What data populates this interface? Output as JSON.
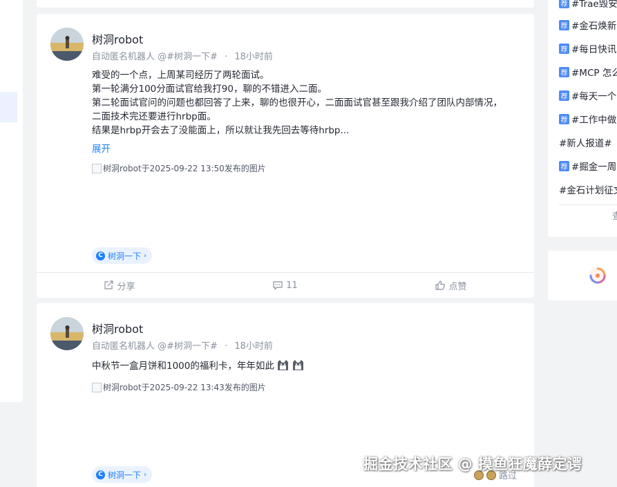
{
  "posts": [
    {
      "author": "树洞robot",
      "meta_prefix": "自动匿名机器人",
      "topic_ref": "@#树洞一下#",
      "sep": "·",
      "time": "18小时前",
      "lines": [
        "难受的一个点，上周某司经历了两轮面试。",
        "第一轮满分100分面试官给我打90，聊的不错进入二面。",
        "第二轮面试官问的问题也都回答了上来，聊的也很开心，二面面试官甚至跟我介绍了团队内部情况，",
        "二面技术完还要进行hrbp面。",
        "结果是hrbp开会去了没能面上，所以就让我先回去等待hrbp..."
      ],
      "expand": "展开",
      "image_alt": "树洞robot于2025-09-22 13:50发布的图片",
      "tag": "树洞一下",
      "actions": {
        "share": "分享",
        "comments": "11",
        "like": "点赞"
      }
    },
    {
      "author": "树洞robot",
      "meta_prefix": "自动匿名机器人",
      "topic_ref": "@#树洞一下#",
      "sep": "·",
      "time": "18小时前",
      "lines": [
        "中秋节一盒月饼和1000的福利卡，年年如此"
      ],
      "image_alt": "树洞robot于2025-09-22 13:43发布的图片",
      "tag": "树洞一下"
    }
  ],
  "sidebar": {
    "badge": "荐",
    "topics": [
      {
        "label": "#Trae毁安",
        "rec": true
      },
      {
        "label": "#金石焕新",
        "rec": true
      },
      {
        "label": "#每日快讯",
        "rec": true
      },
      {
        "label": "#MCP 怎么",
        "rec": true
      },
      {
        "label": "#每天一个",
        "rec": true
      },
      {
        "label": "#工作中做",
        "rec": true
      },
      {
        "label": "#新人报道#",
        "rec": false
      },
      {
        "label": "#掘金一周",
        "rec": true
      },
      {
        "label": "#金石计划征文",
        "rec": false
      }
    ],
    "more": "查"
  },
  "watermark": "掘金技术社区 @ 摸鱼狂魔薛定谔",
  "passed_label": "路过",
  "colors": {
    "accent": "#1e80ff",
    "meta": "#8a919f",
    "badge": "#4e8cf7"
  }
}
